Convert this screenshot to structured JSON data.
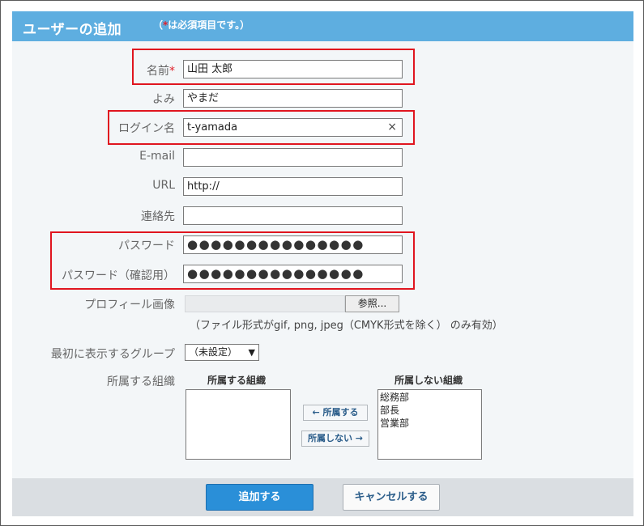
{
  "header": {
    "title": "ユーザーの追加",
    "note_open": "（",
    "note_star": "*",
    "note_text": "は必須項目です。）"
  },
  "form": {
    "name": {
      "label": "名前",
      "required_mark": "*",
      "value": "山田 太郎"
    },
    "yomi": {
      "label": "よみ",
      "value": "やまだ"
    },
    "login": {
      "label": "ログイン名",
      "value": "t-yamada",
      "clear_icon": "×"
    },
    "email": {
      "label": "E-mail",
      "value": ""
    },
    "url": {
      "label": "URL",
      "value": "http://"
    },
    "contact": {
      "label": "連絡先",
      "value": ""
    },
    "password": {
      "label": "パスワード",
      "value": "●●●●●●●●●●●●●●●"
    },
    "password_confirm": {
      "label": "パスワード（確認用）",
      "value": "●●●●●●●●●●●●●●●"
    },
    "profile_image": {
      "label": "プロフィール画像",
      "browse_label": "参照...",
      "hint": "（ファイル形式がgif, png, jpeg（CMYK形式を除く） のみ有効）"
    },
    "first_group": {
      "label": "最初に表示するグループ",
      "selected": "（未設定）"
    },
    "organizations": {
      "label": "所属する組織",
      "assigned_header": "所属する組織",
      "unassigned_header": "所属しない組織",
      "assigned_items": [],
      "unassigned_items": [
        "総務部",
        "部長",
        "営業部"
      ],
      "assign_button": "← 所属する",
      "unassign_button": "所属しない →"
    }
  },
  "footer": {
    "add_button": "追加する",
    "cancel_button": "キャンセルする"
  }
}
